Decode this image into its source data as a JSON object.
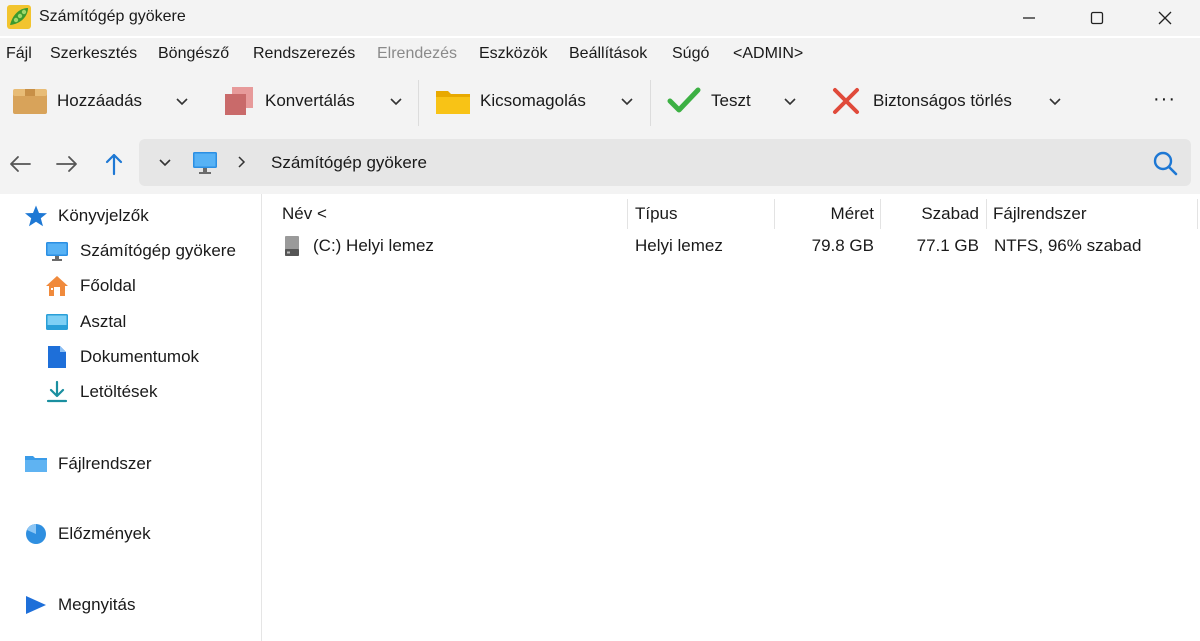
{
  "window": {
    "title": "Számítógép gyökere",
    "app_icon": "peapod-icon"
  },
  "menu": [
    "Fájl",
    "Szerkesztés",
    "Böngésző",
    "Rendszerezés",
    "Elrendezés",
    "Eszközök",
    "Beállítások",
    "Súgó",
    "<ADMIN>"
  ],
  "toolbar": {
    "add_label": "Hozzáadás",
    "convert_label": "Konvertálás",
    "extract_label": "Kicsomagolás",
    "test_label": "Teszt",
    "secure_delete_label": "Biztonságos törlés",
    "more_label": "···"
  },
  "address": {
    "path_label": "Számítógép gyökere"
  },
  "sidebar": {
    "bookmarks": "Könyvjelzők",
    "items": [
      {
        "label": "Számítógép gyökere",
        "icon": "monitor-icon"
      },
      {
        "label": "Főoldal",
        "icon": "home-icon"
      },
      {
        "label": "Asztal",
        "icon": "desktop-icon"
      },
      {
        "label": "Dokumentumok",
        "icon": "document-icon"
      },
      {
        "label": "Letöltések",
        "icon": "download-icon"
      }
    ],
    "filesystem": "Fájlrendszer",
    "history": "Előzmények",
    "open": "Megnyitás"
  },
  "table": {
    "columns": {
      "name": "Név <",
      "type": "Típus",
      "size": "Méret",
      "free": "Szabad",
      "filesystem": "Fájlrendszer"
    },
    "rows": [
      {
        "name": "(C:) Helyi lemez",
        "type": "Helyi lemez",
        "size": "79.8 GB",
        "free": "77.1 GB",
        "filesystem": "NTFS, 96% szabad"
      }
    ]
  },
  "colors": {
    "chrome": "#f3f3f3",
    "accent": "#1e78d4",
    "check": "#3cb043",
    "delete": "#e04a3a"
  }
}
